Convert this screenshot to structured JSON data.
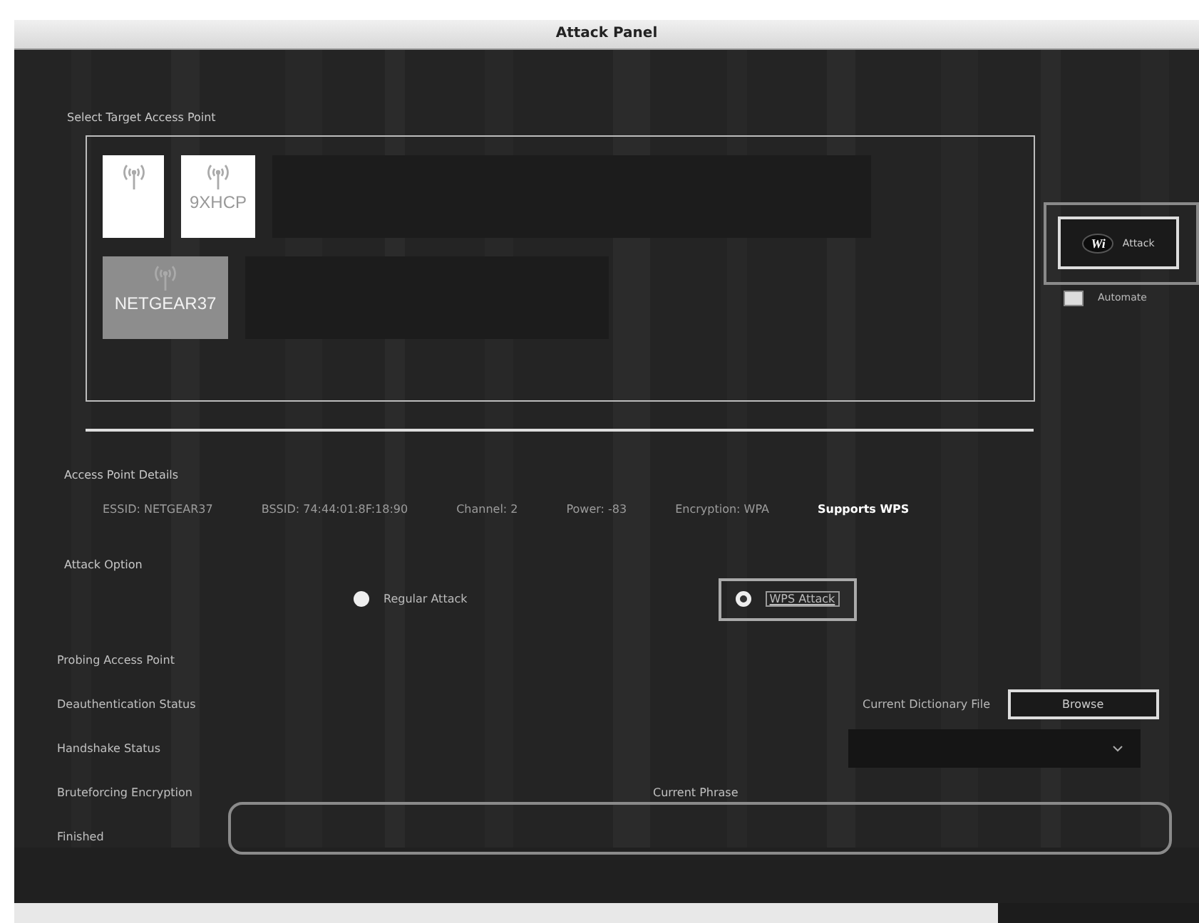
{
  "window": {
    "title": "Attack Panel"
  },
  "target": {
    "label": "Select Target Access Point",
    "rows": [
      {
        "access_points": [
          {
            "selected": false
          },
          {
            "name": "9XHCP",
            "selected": false
          }
        ]
      },
      {
        "access_points": [
          {
            "name": "NETGEAR37",
            "selected": true
          }
        ]
      }
    ]
  },
  "attack_button": {
    "logo": "Wi",
    "label": "Attack"
  },
  "automate": {
    "label": "Automate",
    "checked": false
  },
  "details": {
    "label": "Access Point Details",
    "fields": [
      {
        "text": "ESSID: NETGEAR37",
        "kind": "field"
      },
      {
        "text": "BSSID: 74:44:01:8F:18:90",
        "kind": "field"
      },
      {
        "text": "Channel: 2",
        "kind": "field"
      },
      {
        "text": "Power: -83",
        "kind": "field"
      },
      {
        "text": "Encryption: WPA",
        "kind": "field"
      },
      {
        "text": "Supports WPS",
        "kind": "flag"
      }
    ]
  },
  "attack_option": {
    "label": "Attack Option",
    "options": [
      {
        "label": "Regular Attack",
        "selected": false
      },
      {
        "label": "WPS Attack",
        "selected": true
      }
    ]
  },
  "status": [
    "Probing Access Point",
    "Deauthentication Status",
    "Handshake Status",
    "Bruteforcing Encryption",
    "Finished"
  ],
  "dictionary": {
    "label": "Current Dictionary File",
    "button": "Browse"
  },
  "current_phrase": {
    "label": "Current Phrase"
  }
}
